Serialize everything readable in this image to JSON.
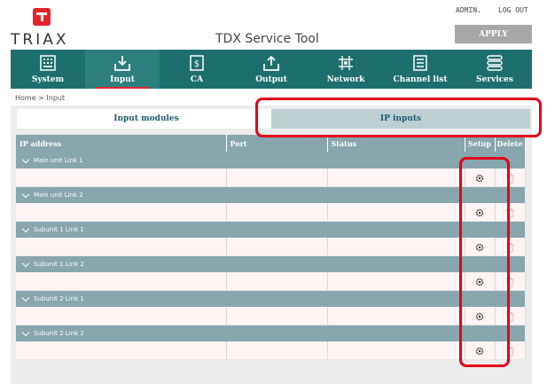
{
  "brand": {
    "logo_text": "TRIAX"
  },
  "header": {
    "app_title": "TDX Service Tool",
    "admin_label": "ADMIN.",
    "logout_label": "LOG OUT",
    "apply_label": "APPLY"
  },
  "nav": {
    "items": [
      {
        "label": "System",
        "icon": "system-icon"
      },
      {
        "label": "Input",
        "icon": "input-icon",
        "active": true
      },
      {
        "label": "CA",
        "icon": "ca-icon"
      },
      {
        "label": "Output",
        "icon": "output-icon"
      },
      {
        "label": "Network",
        "icon": "network-icon"
      },
      {
        "label": "Channel list",
        "icon": "channel-list-icon"
      },
      {
        "label": "Services",
        "icon": "services-icon"
      }
    ]
  },
  "breadcrumb": "Home > Input",
  "tabs": {
    "input_modules": "Input modules",
    "ip_inputs": "IP inputs"
  },
  "table": {
    "columns": {
      "ip_address": "IP address",
      "port": "Port",
      "status": "Status",
      "setup": "Setup",
      "delete": "Delete"
    },
    "groups": [
      {
        "name": "Main unit Link 1"
      },
      {
        "name": "Main unit Link 2"
      },
      {
        "name": "Subunit 1 Link 1"
      },
      {
        "name": "Subunit 1 Link 2"
      },
      {
        "name": "Subunit 2 Link 1"
      },
      {
        "name": "Subunit 2 Link 2"
      }
    ]
  },
  "colors": {
    "nav_background": "#1d6f6e",
    "brand_red": "#e3242b",
    "table_header": "#87a6ad",
    "highlight_box": "#e3001b"
  }
}
